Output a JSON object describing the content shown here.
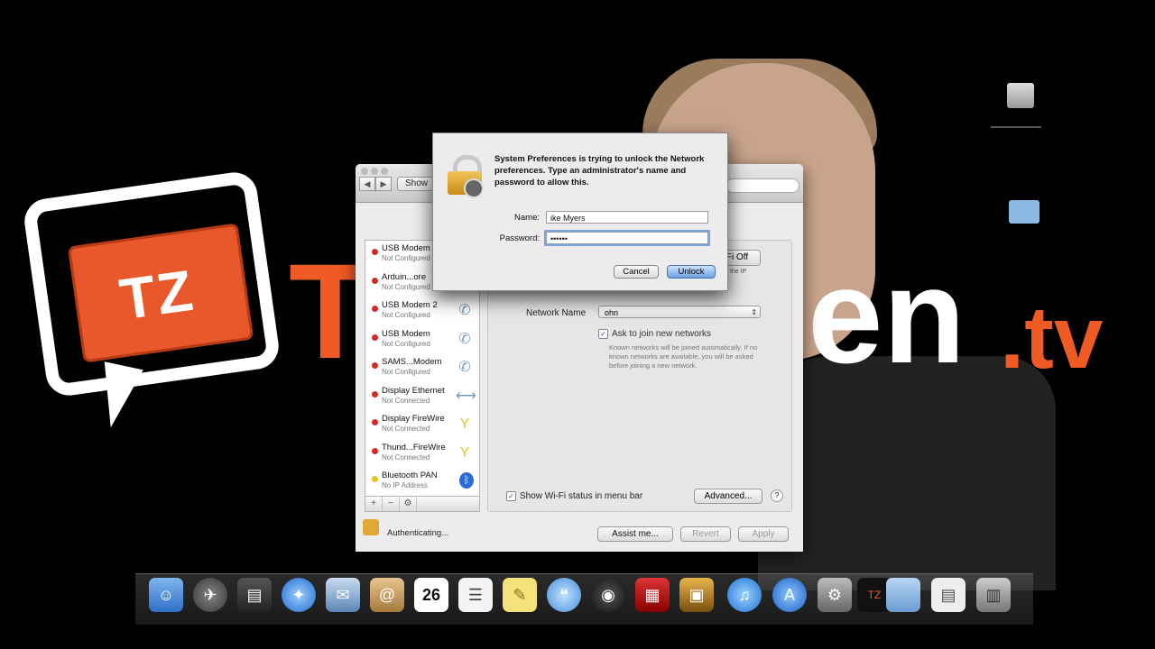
{
  "background": {
    "logo_text": "TZ",
    "brand_left": "T",
    "brand_right": "en",
    "brand_tld": ".tv"
  },
  "network_window": {
    "toolbar": {
      "back": "◀",
      "forward": "▶",
      "show_all_label": "Show"
    },
    "services": [
      {
        "name": "USB Modem",
        "status": "Not Configured",
        "dot": "red",
        "icon": "phone-icon"
      },
      {
        "name": "Arduin...ore",
        "status": "Not Configured",
        "dot": "red",
        "icon": "phone-icon"
      },
      {
        "name": "USB Modem 2",
        "status": "Not Configured",
        "dot": "red",
        "icon": "phone-icon"
      },
      {
        "name": "USB Modem",
        "status": "Not Configured",
        "dot": "red",
        "icon": "phone-icon"
      },
      {
        "name": "SAMS...Modem",
        "status": "Not Configured",
        "dot": "red",
        "icon": "phone-icon"
      },
      {
        "name": "Display Ethernet",
        "status": "Not Connected",
        "dot": "red",
        "icon": "ethernet-icon"
      },
      {
        "name": "Display FireWire",
        "status": "Not Connected",
        "dot": "red",
        "icon": "firewire-icon"
      },
      {
        "name": "Thund...FireWire",
        "status": "Not Connected",
        "dot": "red",
        "icon": "firewire-icon"
      },
      {
        "name": "Bluetooth PAN",
        "status": "No IP Address",
        "dot": "yellow",
        "icon": "bluetooth-icon"
      }
    ],
    "sidebar_footer": {
      "add": "+",
      "remove": "−",
      "action": "⚙"
    },
    "detail": {
      "wifi_button": "Fi Off",
      "ip_note": "the IP",
      "network_name_label": "Network Name",
      "network_name_value": "ohn",
      "ask_join_label": "Ask to join new networks",
      "known_networks_note": "Known networks will be joined automatically. If no known networks are available, you will be asked before joining a new network.",
      "show_wifi_label": "Show Wi-Fi status in menu bar",
      "advanced_button": "Advanced...",
      "help": "?"
    },
    "footer": {
      "status": "Authenticating...",
      "assist_button": "Assist me...",
      "revert_button": "Revert",
      "apply_button": "Apply"
    }
  },
  "auth_dialog": {
    "message": "System Preferences is trying to unlock the Network preferences. Type an administrator's name and password to allow this.",
    "name_label": "Name:",
    "name_value": "ike Myers",
    "password_label": "Password:",
    "password_value": "••••••",
    "cancel_button": "Cancel",
    "unlock_button": "Unlock"
  },
  "dock": {
    "calendar_day": "26",
    "items": [
      "finder-icon",
      "launchpad-icon",
      "mission-control-icon",
      "safari-icon",
      "mail-icon",
      "contacts-icon",
      "calendar-icon",
      "reminders-icon",
      "notes-icon",
      "messages-icon",
      "facetime-icon",
      "photo-booth-icon",
      "preview-icon",
      "itunes-icon",
      "app-store-icon",
      "system-preferences-icon",
      "techzen-icon",
      "folder-icon",
      "documents-icon",
      "trash-icon"
    ]
  }
}
